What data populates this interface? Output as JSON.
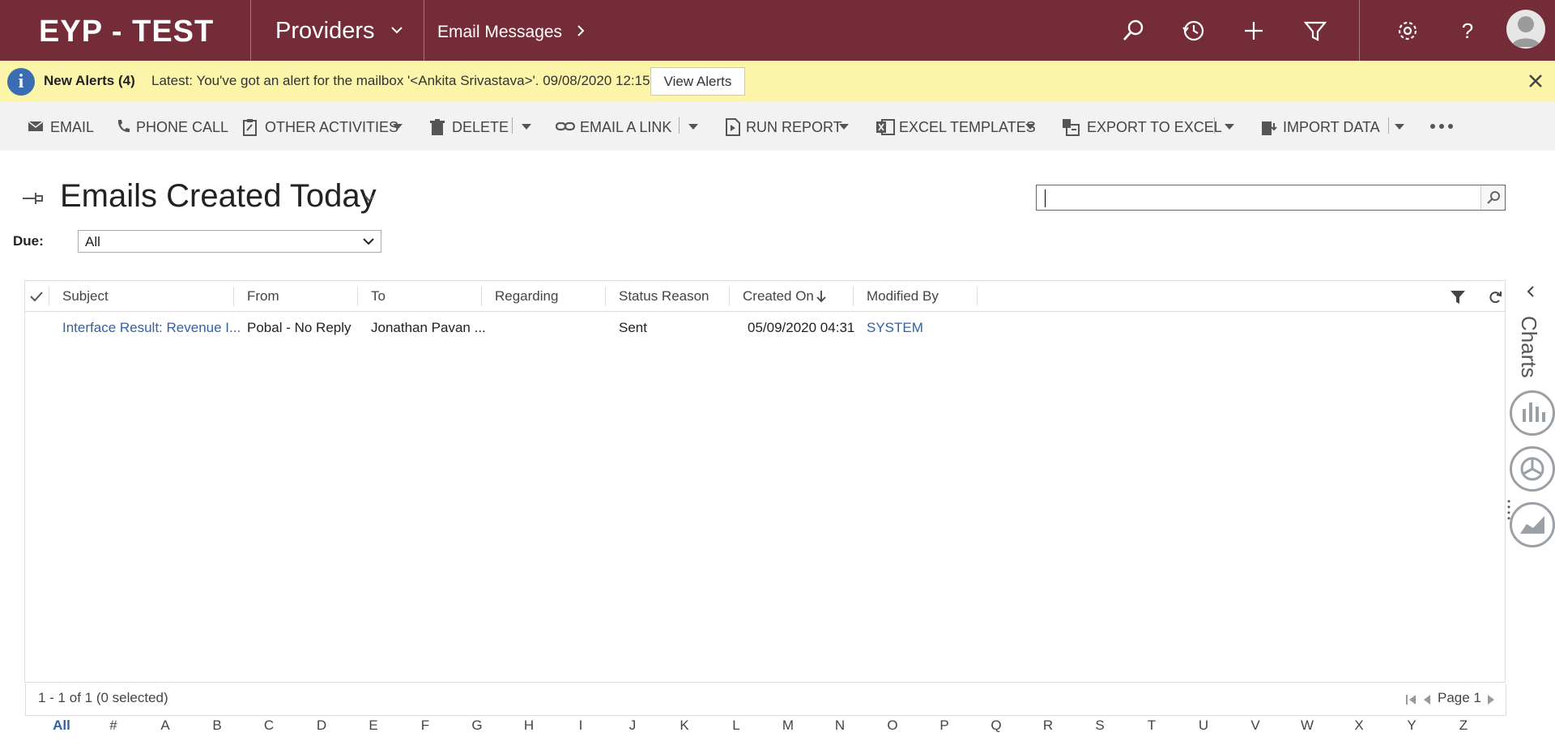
{
  "app": {
    "brand": "EYP - TEST",
    "area": "Providers",
    "entity": "Email Messages"
  },
  "alert": {
    "title": "New Alerts (4)",
    "message": "Latest: You've got an alert for the mailbox '<Ankita Srivastava>'. 09/08/2020 12:15",
    "button": "View Alerts"
  },
  "commands": {
    "email": "EMAIL",
    "phone_call": "PHONE CALL",
    "other_activities": "OTHER ACTIVITIES",
    "delete": "DELETE",
    "email_link": "EMAIL A LINK",
    "run_report": "RUN REPORT",
    "excel_templates": "EXCEL TEMPLATES",
    "export_excel": "EXPORT TO EXCEL",
    "import_data": "IMPORT DATA"
  },
  "view": {
    "title": "Emails Created Today",
    "due_label": "Due:",
    "due_value": "All"
  },
  "grid": {
    "columns": [
      "Subject",
      "From",
      "To",
      "Regarding",
      "Status Reason",
      "Created On",
      "Modified By"
    ],
    "rows": [
      {
        "subject": "Interface Result: Revenue I...",
        "from": "Pobal - No Reply",
        "to": "Jonathan Pavan ...",
        "regarding": "",
        "status": "Sent",
        "created": "05/09/2020 04:31",
        "modified_by": "SYSTEM"
      }
    ],
    "count": "1 - 1 of 1 (0 selected)",
    "page": "Page 1"
  },
  "jump_letters": [
    "All",
    "#",
    "A",
    "B",
    "C",
    "D",
    "E",
    "F",
    "G",
    "H",
    "I",
    "J",
    "K",
    "L",
    "M",
    "N",
    "O",
    "P",
    "Q",
    "R",
    "S",
    "T",
    "U",
    "V",
    "W",
    "X",
    "Y",
    "Z"
  ],
  "charts_label": "Charts",
  "colors": {
    "nav": "#742d38",
    "alert": "#fcf4a9",
    "link": "#2f62a9",
    "command_bar": "#f2f2f2"
  }
}
